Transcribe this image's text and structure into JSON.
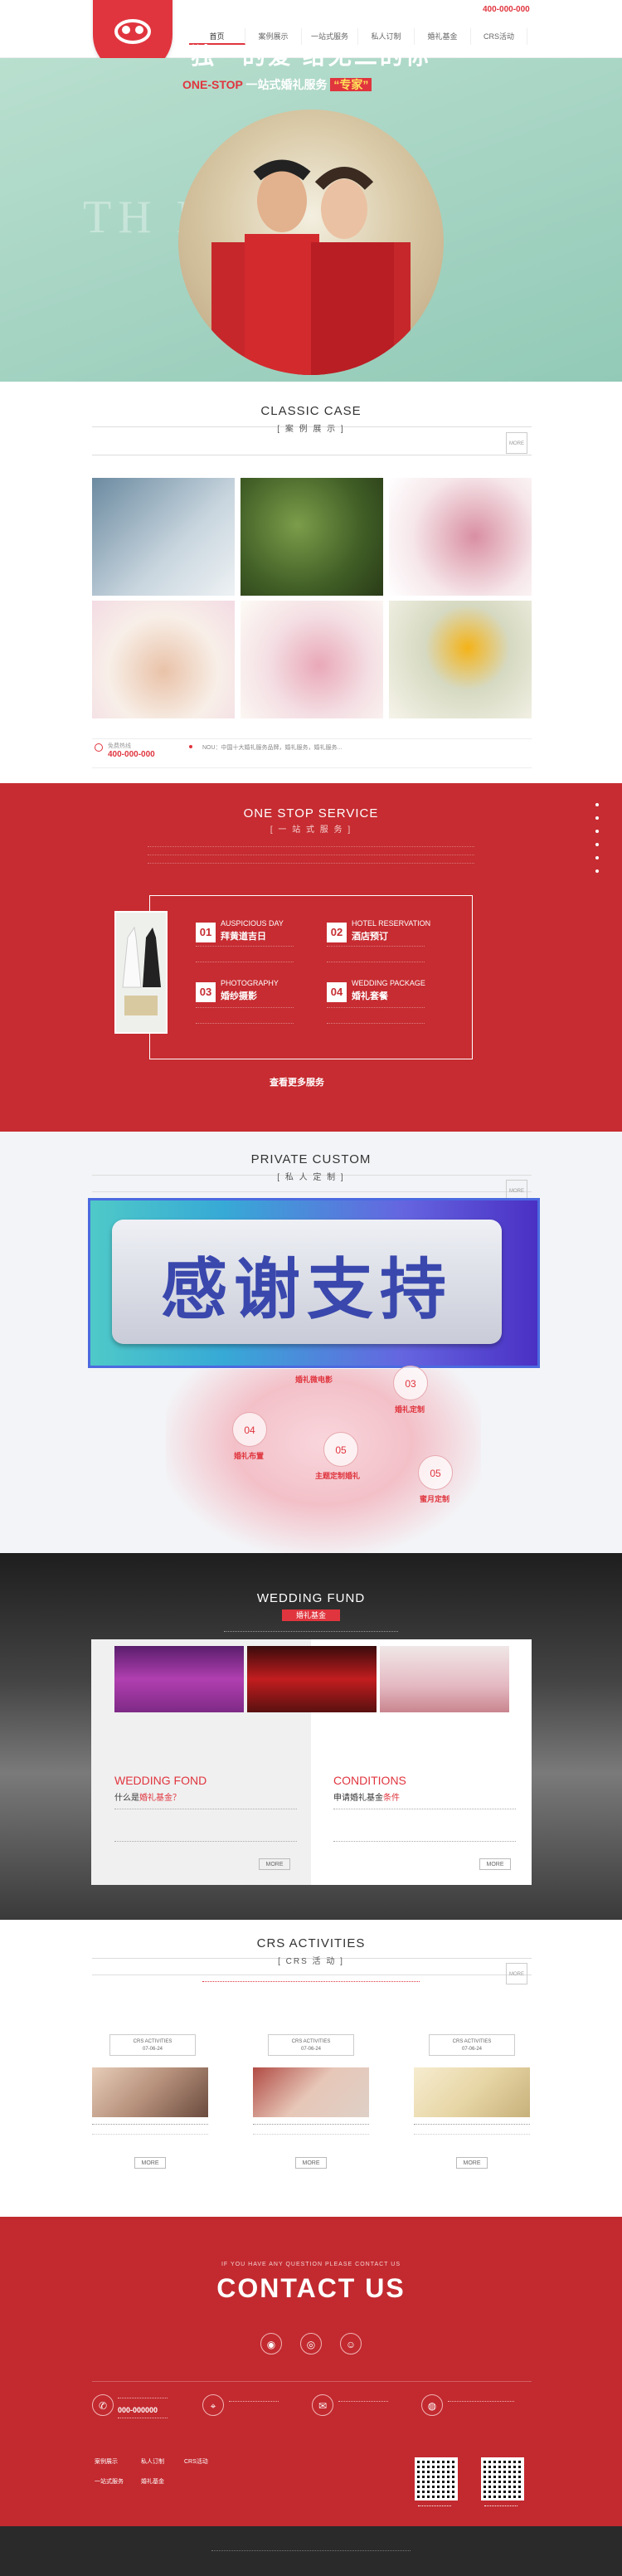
{
  "header": {
    "nav": [
      "首页",
      "案例展示",
      "一站式服务",
      "私人订制",
      "婚礼基金",
      "CRS活动"
    ],
    "phone": "400-000-000"
  },
  "banner": {
    "title": "独一的爱  给无二的你",
    "sub_onestop": "ONE-STOP",
    "sub_mid": " 一站式婚礼服务 ",
    "sub_expert": "“专家”",
    "watermark": "TH          NG"
  },
  "classic": {
    "en": "CLASSIC CASE",
    "cn": "[ 案 例 展 示 ]",
    "more": "MORE",
    "phone_label": "免费热线",
    "phone": "400-000-000",
    "news": "NOU：中国十大婚礼服务品牌，婚礼服务，婚礼服务..."
  },
  "service": {
    "en": "ONE STOP SERVICE",
    "cn": "[ 一 站 式 服 务 ]",
    "items": [
      {
        "num": "01",
        "en": "AUSPICIOUS DAY",
        "cn": "拜黄道吉日"
      },
      {
        "num": "02",
        "en": "HOTEL RESERVATION",
        "cn": "酒店预订"
      },
      {
        "num": "03",
        "en": "PHOTOGRAPHY",
        "cn": "婚纱摄影"
      },
      {
        "num": "04",
        "en": "WEDDING PACKAGE",
        "cn": "婚礼套餐"
      }
    ],
    "more": "查看更多服务"
  },
  "private": {
    "en": "PRIVATE CUSTOM",
    "cn": "[ 私 人 定 制 ]",
    "more": "MORE",
    "thanks": "感谢支持",
    "circles": [
      {
        "num": "03",
        "label": "婚礼定制"
      },
      {
        "num": "04",
        "label": "婚礼布置"
      },
      {
        "num": "05",
        "label": "主题定制婚礼"
      },
      {
        "num": "05",
        "label": "蜜月定制"
      }
    ],
    "label_top": "婚礼微电影"
  },
  "fund": {
    "en": "WEDDING FUND",
    "cn": "婚礼基金",
    "left_en": "WEDDING FOND",
    "left_cn_a": "什么是",
    "left_cn_b": "婚礼基金？",
    "right_en": "CONDITIONS",
    "right_cn_a": "申请婚礼基金",
    "right_cn_b": "条件",
    "more": "MORE"
  },
  "activities": {
    "en": "CRS ACTIVITIES",
    "cn": "[ CRS 活 动 ]",
    "more": "MORE",
    "cards": [
      {
        "tag": "CRS ACTIVITIES",
        "date": "07-06-24"
      },
      {
        "tag": "CRS ACTIVITIES",
        "date": "07-06-24"
      },
      {
        "tag": "CRS ACTIVITIES",
        "date": "07-06-24"
      }
    ],
    "card_more": "MORE"
  },
  "contact": {
    "small": "IF YOU HAVE ANY QUESTION PLEASE CONTACT US",
    "title": "CONTACT US",
    "phone": "000-000000",
    "footer_links": [
      "案例展示",
      "私人订制",
      "CRS活动",
      "一站式服务",
      "婚礼基金"
    ]
  },
  "colors": {
    "brand": "#e0353e",
    "service_bg": "#c62c31",
    "contact_bg": "#c22a2f"
  }
}
